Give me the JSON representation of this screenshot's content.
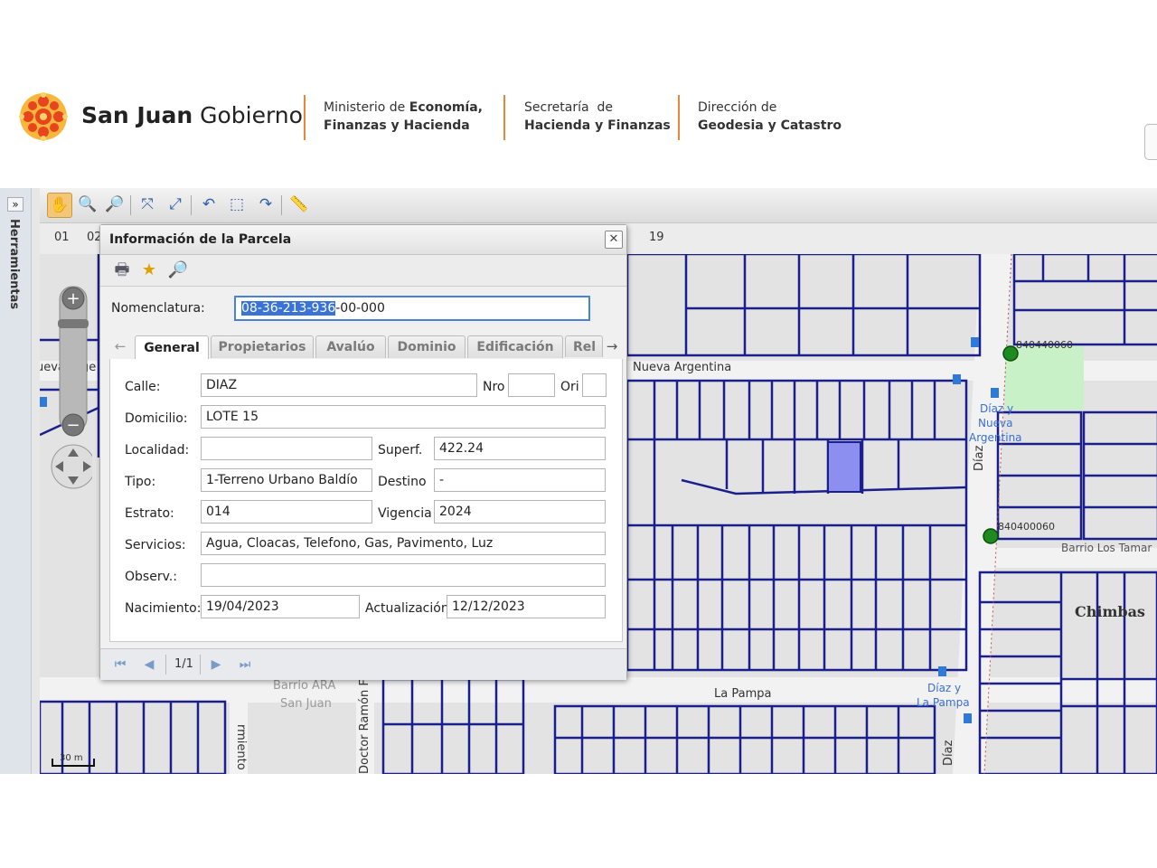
{
  "header": {
    "brand_bold": "San Juan",
    "brand_light": "Gobierno",
    "block1_line1_a": "Ministerio de ",
    "block1_line1_b": "Economía,",
    "block1_line2": "Finanzas y Hacienda",
    "block2_line1": "Secretaría  de",
    "block2_line2": "Hacienda y Finanzas",
    "block3_line1": "Dirección de",
    "block3_line2": "Geodesia y Catastro",
    "accent_color": "#e8863a"
  },
  "sidebar": {
    "label": "Herramientas",
    "toggle": "»"
  },
  "toolbar": {
    "icons": [
      "pan-hand-icon",
      "zoom-in-icon",
      "zoom-out-icon",
      "zoom-extent-icon",
      "zoom-full-icon",
      "undo-view-icon",
      "zoom-box-icon",
      "redo-view-icon",
      "measure-icon"
    ]
  },
  "scale_labels": [
    "01",
    "02",
    "19"
  ],
  "map": {
    "streets": {
      "nueva_argentina": "Nueva Argentina",
      "nueva_arge_left": "ueva Arge",
      "la_pampa": "La Pampa",
      "diaz_1": "Díaz",
      "diaz_2": "Díaz",
      "sarmiento": "rmiento",
      "doctor_ramon": "Doctor Ramón F",
      "barrio_ara": "Barrio ARA",
      "san_juan": "San Juan",
      "barrio_los_tamar": "Barrio Los Tamar",
      "chimbas": "Chimbas"
    },
    "stops": {
      "diaz_nueva_argentina": [
        "Díaz y",
        "Nueva",
        "Argentina"
      ],
      "diaz_la_pampa": [
        "Díaz y",
        "La Pampa"
      ]
    },
    "points": [
      "840440060",
      "840400060"
    ],
    "scale": "30 m",
    "highlight_color": "#8c8ff0"
  },
  "dialog": {
    "title": "Información de la Parcela",
    "close": "✕",
    "nomenclatura_label": "Nomenclatura:",
    "nomenclatura_selected": "08-36-213-936",
    "nomenclatura_rest": "-00-000",
    "tabs": [
      "General",
      "Propietarios",
      "Avalúo",
      "Dominio",
      "Edificación",
      "Rel"
    ],
    "active_tab": "General",
    "fields": {
      "calle": {
        "label": "Calle:",
        "value": "DIAZ"
      },
      "nro": {
        "label": "Nro",
        "value": ""
      },
      "ori": {
        "label": "Ori",
        "value": ""
      },
      "domicilio": {
        "label": "Domicilio:",
        "value": "LOTE 15"
      },
      "localidad": {
        "label": "Localidad:",
        "value": ""
      },
      "superf": {
        "label": "Superf.",
        "value": "422.24"
      },
      "tipo": {
        "label": "Tipo:",
        "value": "1-Terreno Urbano Baldío"
      },
      "destino": {
        "label": "Destino",
        "value": "-"
      },
      "estrato": {
        "label": "Estrato:",
        "value": "014"
      },
      "vigencia": {
        "label": "Vigencia",
        "value": "2024"
      },
      "servicios": {
        "label": "Servicios:",
        "value": "Agua, Cloacas, Telefono, Gas, Pavimento, Luz"
      },
      "observ": {
        "label": "Observ.:",
        "value": ""
      },
      "nacimiento": {
        "label": "Nacimiento:",
        "value": "19/04/2023"
      },
      "actualizacion": {
        "label": "Actualización",
        "value": "12/12/2023"
      }
    },
    "pager": {
      "page": "1/1"
    }
  }
}
